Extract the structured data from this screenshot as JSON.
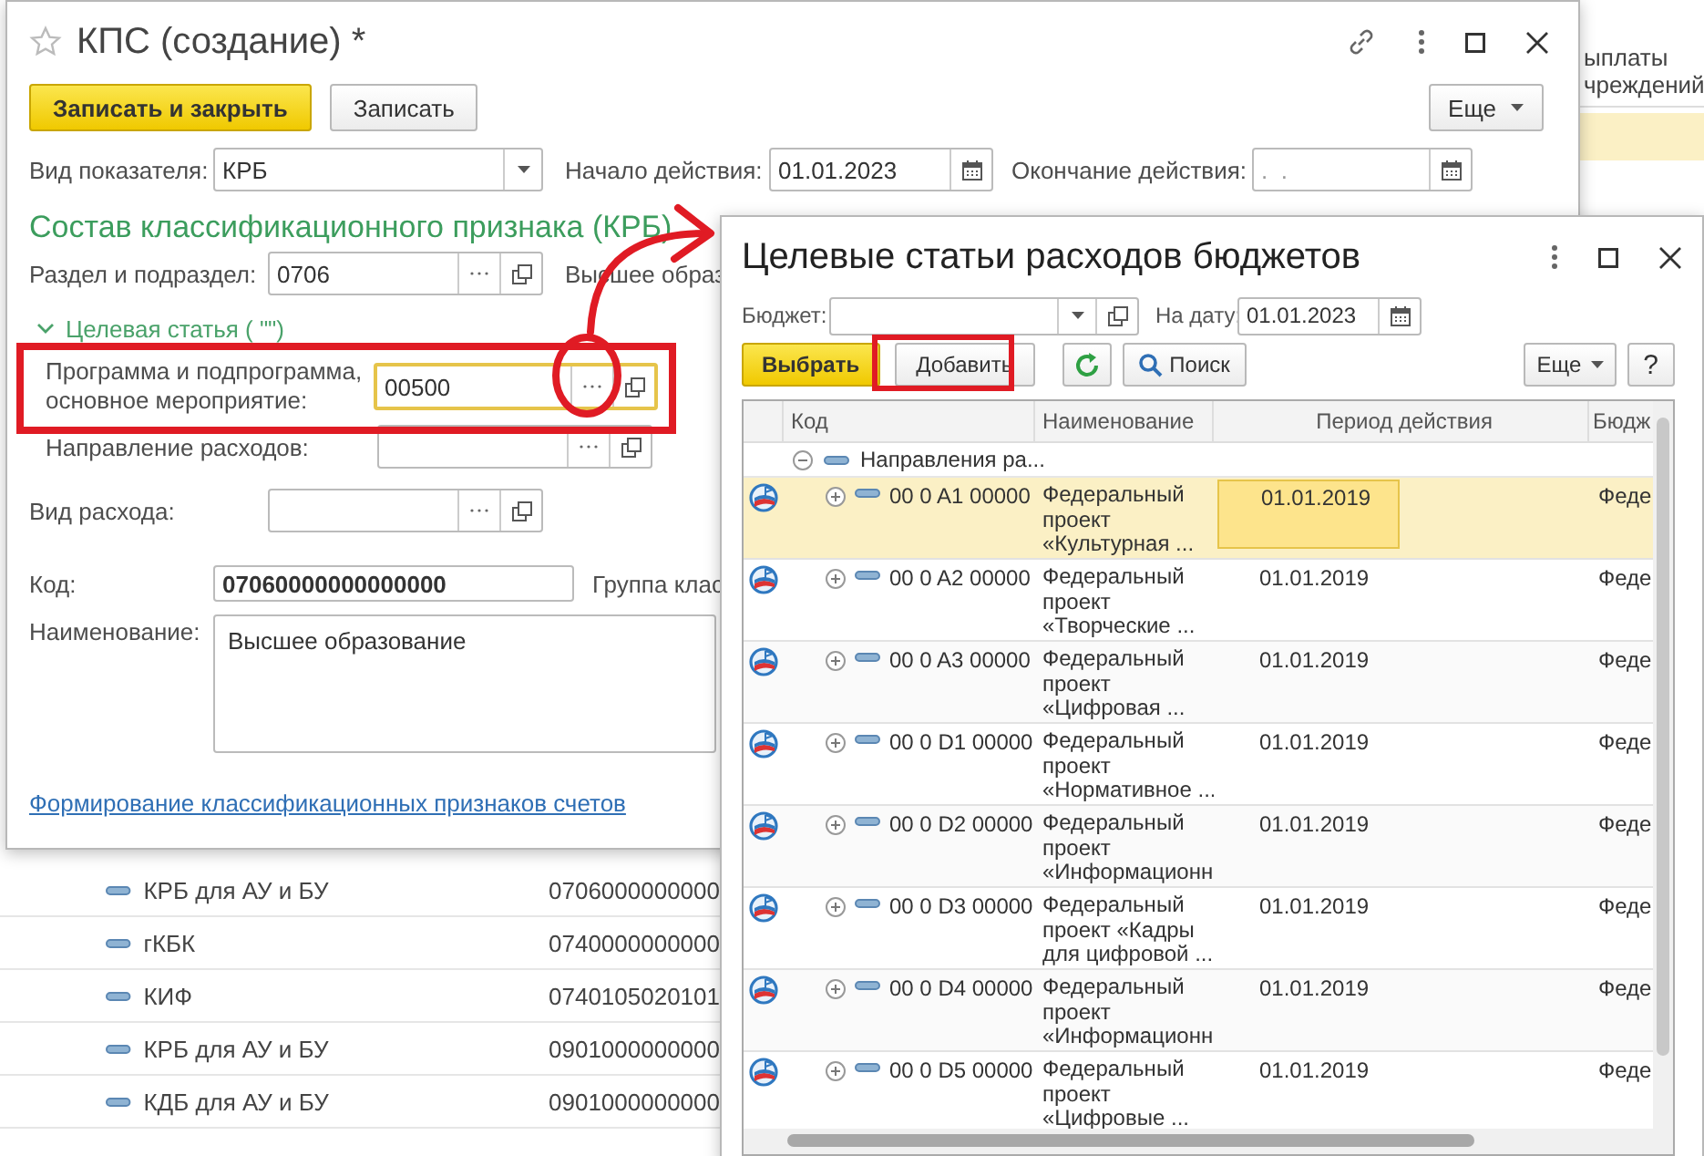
{
  "background_list": {
    "header_lines": [
      "ыплаты",
      "чреждений"
    ],
    "rows": [
      {
        "name": "КРБ для АУ и БУ",
        "code": "0706000000000"
      },
      {
        "name": "гКБК",
        "code": "0740000000000"
      },
      {
        "name": "КИФ",
        "code": "0740105020101"
      },
      {
        "name": "КРБ для АУ и БУ",
        "code": "0901000000000"
      },
      {
        "name": "КДБ для АУ и БУ",
        "code": "0901000000000"
      }
    ]
  },
  "form": {
    "title": "КПС (создание) *",
    "favorite": false,
    "buttons": [
      {
        "label": "Записать и закрыть",
        "kind": "primary"
      },
      {
        "label": "Записать",
        "kind": "default"
      }
    ],
    "more": "Еще",
    "indicator": {
      "label": "Вид показателя:",
      "value": "КРБ"
    },
    "start": {
      "label": "Начало действия:",
      "value": "01.01.2023"
    },
    "end": {
      "label": "Окончание действия:",
      "placeholder": ".  ."
    },
    "section_title": "Состав классификационного признака (КРБ)",
    "section": {
      "label": "Раздел и подраздел:",
      "value": "0706",
      "description": "Высшее образ"
    },
    "group": {
      "title": "Целевая статья ( \"\")",
      "expanded": true
    },
    "program": {
      "label": "Программа и подпрограмма, основное мероприятие:",
      "value": "00500",
      "focused": true
    },
    "direction": {
      "label": "Направление расходов:"
    },
    "expense_type": {
      "label": "Вид расхода:"
    },
    "code": {
      "label": "Код:",
      "value": "07060000000000000",
      "group_label": "Группа клас"
    },
    "name": {
      "label": "Наименование:",
      "value": "Высшее образование"
    },
    "link": "Формирование классификационных признаков счетов"
  },
  "picker": {
    "title": "Целевые статьи расходов бюджетов",
    "budget": {
      "label": "Бюджет:"
    },
    "date": {
      "label": "На дату:",
      "value": "01.01.2023"
    },
    "buttons": {
      "select": "Выбрать",
      "add": "Добавить",
      "search": "Поиск",
      "more": "Еще",
      "help": "?"
    },
    "columns": [
      "Код",
      "Наименование",
      "Период действия",
      "Бюдж"
    ],
    "group_row": {
      "name": "Направления ра...",
      "expanded": true
    },
    "rows": [
      {
        "code": "00 0 A1 00000",
        "name": "Федеральный\nпроект\n«Культурная ...",
        "period": "01.01.2019",
        "budget": "Феде",
        "selected": true
      },
      {
        "code": "00 0 A2 00000",
        "name": "Федеральный\nпроект\n«Творческие ...",
        "period": "01.01.2019",
        "budget": "Феде",
        "selected": false
      },
      {
        "code": "00 0 A3 00000",
        "name": "Федеральный\nпроект\n«Цифровая ...",
        "period": "01.01.2019",
        "budget": "Феде",
        "selected": false
      },
      {
        "code": "00 0 D1 00000",
        "name": "Федеральный\nпроект\n«Нормативное ...",
        "period": "01.01.2019",
        "budget": "Феде",
        "selected": false
      },
      {
        "code": "00 0 D2 00000",
        "name": "Федеральный\nпроект\n«Информационн",
        "period": "01.01.2019",
        "budget": "Феде",
        "selected": false
      },
      {
        "code": "00 0 D3 00000",
        "name": "Федеральный\nпроект «Кадры\nдля цифровой ...",
        "period": "01.01.2019",
        "budget": "Феде",
        "selected": false
      },
      {
        "code": "00 0 D4 00000",
        "name": "Федеральный\nпроект\n«Информационн",
        "period": "01.01.2019",
        "budget": "Феде",
        "selected": false
      },
      {
        "code": "00 0 D5 00000",
        "name": "Федеральный\nпроект\n«Цифровые ...",
        "period": "01.01.2019",
        "budget": "Феде",
        "selected": false
      }
    ]
  }
}
